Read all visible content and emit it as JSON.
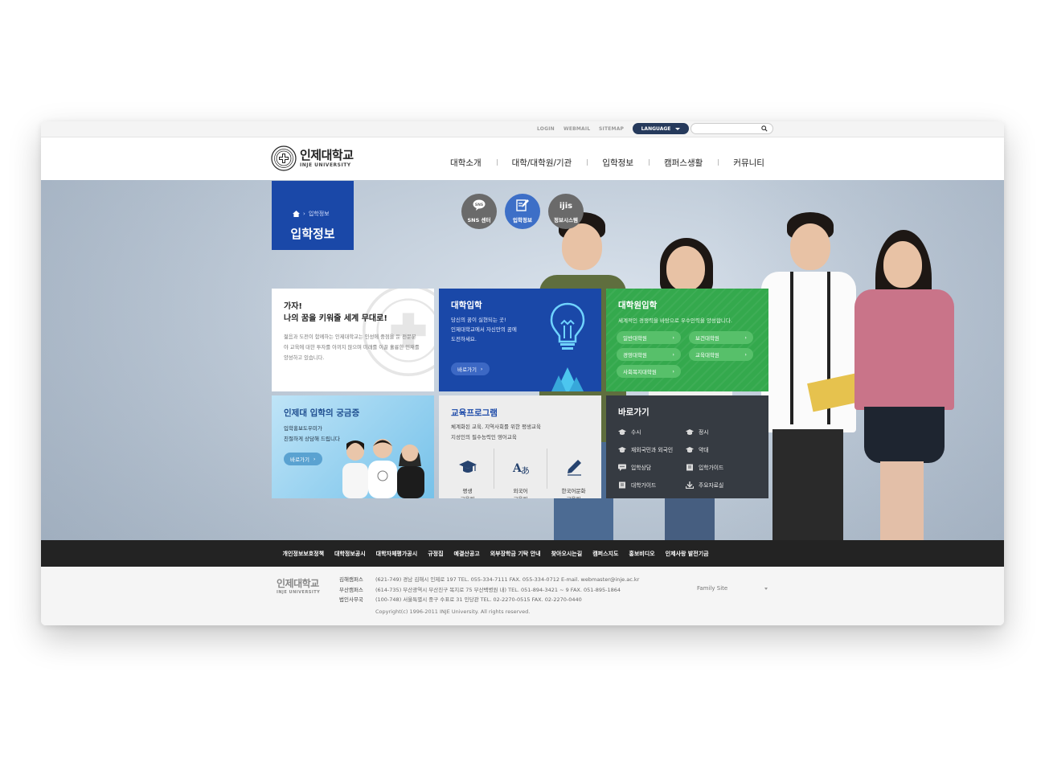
{
  "util": {
    "links": [
      "LOGIN",
      "WEBMAIL",
      "SITEMAP"
    ],
    "language": "LANGUAGE",
    "search_placeholder": ""
  },
  "brand": {
    "name_ko": "인제대학교",
    "name_en": "INJE UNIVERSITY"
  },
  "gnb": [
    "대학소개",
    "대학/대학원/기관",
    "입학정보",
    "캠퍼스생활",
    "커뮤니티"
  ],
  "page": {
    "crumb": "입학정보",
    "title": "입학정보"
  },
  "quick": [
    {
      "label": "SNS 센터",
      "icon": "sns-bubble-icon",
      "color": "#6c6c6c"
    },
    {
      "label": "입학정보",
      "icon": "pencil-note-icon",
      "color": "#3d6fc7"
    },
    {
      "label": "정보시스템",
      "icon": "ijis-icon",
      "color": "#6c6c6c"
    }
  ],
  "cards": {
    "intro": {
      "title": "가자!\n나의 꿈을 키워줄 세계 무대로!",
      "desc": "젊음과 도전이 함께하는 인제대학교는 인성에 중점을 둔 전문분야 교육에 대한 투자를 아끼지 않으며 미래를 이끌 훌륭한 인재를 양성하고 있습니다."
    },
    "undergrad": {
      "title": "대학입학",
      "desc": "당신의 꿈이 실현되는 곳!\n인제대학교에서 자신만의 꿈에\n도전하세요.",
      "button": "바로가기"
    },
    "graduate": {
      "title": "대학원입학",
      "desc": "세계적인 경쟁력을 바탕으로 우수인력을 양성합니다.",
      "buttons": [
        "일반대학원",
        "보건대학원",
        "경영대학원",
        "교육대학원",
        "사회복지대학원"
      ]
    },
    "faq": {
      "title": "인제대 입학의 궁금증",
      "desc": "입학홍보도우미가\n친절하게 상담해 드립니다",
      "button": "바로가기"
    },
    "edu": {
      "title": "교육프로그램",
      "desc": "체계화된 교육, 지역사회를 위한 평생교육\n지성인의 필수능력인 영어교육",
      "items": [
        {
          "label": "평생\n교육원",
          "icon": "graduation-cap-icon"
        },
        {
          "label": "외국어\n교육원",
          "icon": "language-icon"
        },
        {
          "label": "한국어문화\n교육원",
          "icon": "pen-icon"
        }
      ]
    },
    "shortcut": {
      "title": "바로가기",
      "links": [
        {
          "label": "수시",
          "icon": "cap-icon"
        },
        {
          "label": "정시",
          "icon": "cap-icon"
        },
        {
          "label": "재외국민과 외국인",
          "icon": "cap-icon"
        },
        {
          "label": "약대",
          "icon": "cap-icon"
        },
        {
          "label": "입학상담",
          "icon": "chat-icon"
        },
        {
          "label": "입학가이드",
          "icon": "book-icon"
        },
        {
          "label": "대학가이드",
          "icon": "book-icon"
        },
        {
          "label": "주요자료실",
          "icon": "download-icon"
        }
      ]
    }
  },
  "footer": {
    "nav": [
      "개인정보보호정책",
      "대학정보공시",
      "대학자체평가공시",
      "규정집",
      "예결산공고",
      "외부장학금 기탁 안내",
      "찾아오시는길",
      "캠퍼스지도",
      "홍보비디오",
      "인제사랑 발전기금"
    ],
    "logo_ko": "인제대학교",
    "logo_en": "INJE UNIVERSITY",
    "campuses": [
      {
        "name": "김해캠퍼스",
        "info": "(621-749) 경남 김해시 인제로 197    TEL. 055-334-7111   FAX. 055-334-0712    E-mail. webmaster@inje.ac.kr"
      },
      {
        "name": "부산캠퍼스",
        "info": "(614-735) 부산광역시 부산진구 복지로 75  부산백병원 내)  TEL. 051-894-3421 ~ 9   FAX. 051-895-1864"
      },
      {
        "name": "법인사무국",
        "info": "(100-748) 서울특별시 중구 수표로 31 인당관   TEL. 02-2270-0515   FAX. 02-2270-0440"
      }
    ],
    "copyright": "Copyright(c) 1996-2011 INJE University. All rights reserved.",
    "family_site": "Family Site"
  },
  "colors": {
    "brand_blue": "#1a48a8",
    "green": "#34a94d",
    "dark": "#363b42",
    "navy": "#263a5c"
  }
}
